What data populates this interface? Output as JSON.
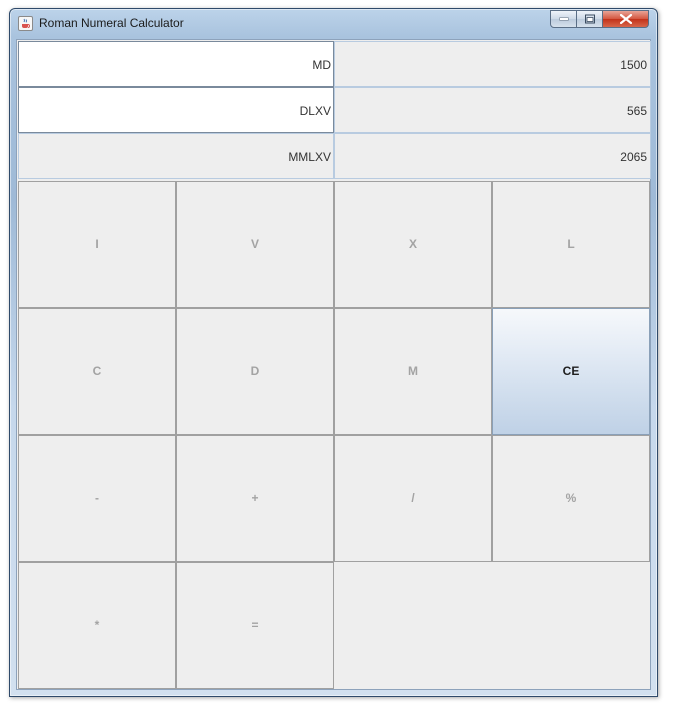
{
  "window": {
    "title": "Roman Numeral Calculator"
  },
  "fields": {
    "operand1_roman": "MD",
    "operand1_value": "1500",
    "operand2_roman": "DLXV",
    "operand2_value": "565",
    "result_roman": "MMLXV",
    "result_value": "2065"
  },
  "buttons": [
    {
      "label": "I",
      "enabled": false
    },
    {
      "label": "V",
      "enabled": false
    },
    {
      "label": "X",
      "enabled": false
    },
    {
      "label": "L",
      "enabled": false
    },
    {
      "label": "C",
      "enabled": false
    },
    {
      "label": "D",
      "enabled": false
    },
    {
      "label": "M",
      "enabled": false
    },
    {
      "label": "CE",
      "enabled": true
    },
    {
      "label": "-",
      "enabled": false
    },
    {
      "label": "+",
      "enabled": false
    },
    {
      "label": "/",
      "enabled": false
    },
    {
      "label": "%",
      "enabled": false
    },
    {
      "label": "*",
      "enabled": false
    },
    {
      "label": "=",
      "enabled": false
    }
  ]
}
